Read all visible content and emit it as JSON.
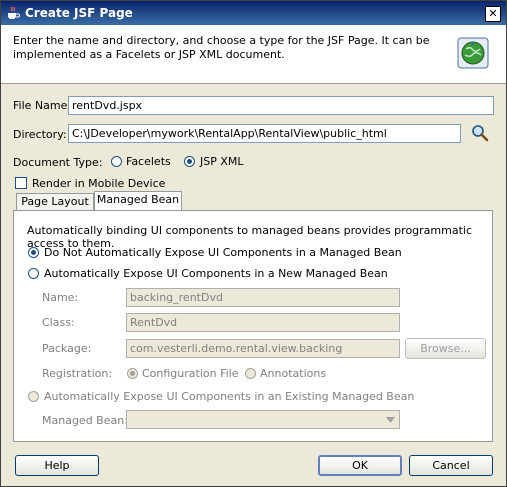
{
  "window": {
    "title": "Create JSF Page",
    "close_glyph": "✕"
  },
  "header": {
    "description": "Enter the name and directory, and choose a type for the JSF Page. It can be implemented as a Facelets or JSP XML document.",
    "icon": "jsf-globe-icon"
  },
  "form": {
    "file_name_label": "File Name:",
    "file_name_value": "rentDvd.jspx",
    "directory_label": "Directory:",
    "directory_value": "C:\\JDeveloper\\mywork\\RentalApp\\RentalView\\public_html",
    "document_type_label": "Document Type:",
    "facelets_label": "Facelets",
    "jspxml_label": "JSP XML",
    "document_type_selected": "JSP XML",
    "mobile_label": "Render in Mobile Device",
    "mobile_checked": false
  },
  "tabs": [
    {
      "label": "Page Layout",
      "active": false
    },
    {
      "label": "Managed Bean",
      "active": true
    }
  ],
  "managed_bean": {
    "description": "Automatically binding UI components to managed beans provides programmatic access to them.",
    "option_none": "Do Not Automatically Expose UI Components in a Managed Bean",
    "option_new": "Automatically Expose UI Components in a New Managed Bean",
    "option_existing": "Automatically Expose UI Components in an Existing Managed Bean",
    "selected": "none",
    "name_label": "Name:",
    "name_value": "backing_rentDvd",
    "class_label": "Class:",
    "class_value": "RentDvd",
    "package_label": "Package:",
    "package_value": "com.vesterli.demo.rental.view.backing",
    "browse_label": "Browse...",
    "registration_label": "Registration:",
    "config_file_label": "Configuration File",
    "annotations_label": "Annotations",
    "registration_selected": "Configuration File",
    "managed_bean_label": "Managed Bean:",
    "managed_bean_value": ""
  },
  "buttons": {
    "help": "Help",
    "ok": "OK",
    "cancel": "Cancel"
  },
  "colors": {
    "title_bar": "#0a246a",
    "accent": "#1c5180"
  }
}
